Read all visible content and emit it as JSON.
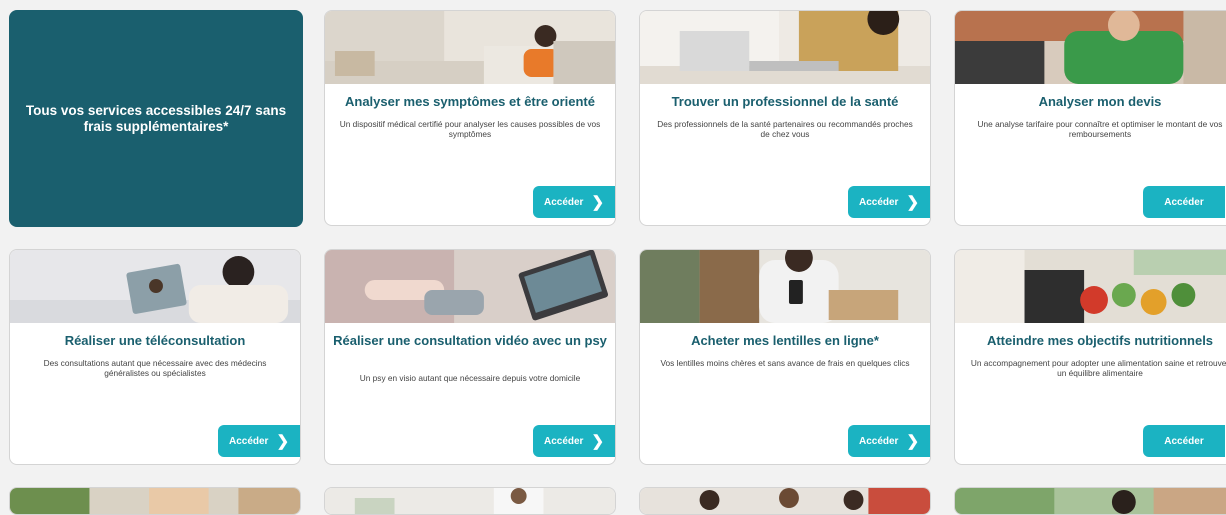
{
  "hero": {
    "text": "Tous vos services accessibles 24/7 sans frais supplémentaires*"
  },
  "cta_label": "Accéder",
  "cards": [
    {
      "title": "Analyser mes symptômes et être orienté",
      "desc": "Un dispositif médical certifié pour analyser les causes possibles de vos symptômes"
    },
    {
      "title": "Trouver un professionnel de la santé",
      "desc": "Des professionnels de la santé partenaires ou recommandés proches de chez vous"
    },
    {
      "title": "Analyser mon devis",
      "desc": "Une analyse tarifaire pour connaître et optimiser le montant de vos remboursements"
    },
    {
      "title": "Réaliser une téléconsultation",
      "desc": "Des consultations autant que nécessaire avec des médecins généralistes ou spécialistes"
    },
    {
      "title": "Réaliser une consultation vidéo avec un psy",
      "desc": "Un psy en visio autant que nécessaire depuis votre domicile"
    },
    {
      "title": "Acheter mes lentilles en ligne*",
      "desc": "Vos lentilles moins chères et sans avance de frais en quelques clics"
    },
    {
      "title": "Atteindre mes objectifs nutritionnels",
      "desc": "Un accompagnement pour adopter une alimentation saine et retrouver un équilibre alimentaire"
    }
  ],
  "colors": {
    "primary": "#1a5f6e",
    "accent": "#1bb3c2"
  }
}
